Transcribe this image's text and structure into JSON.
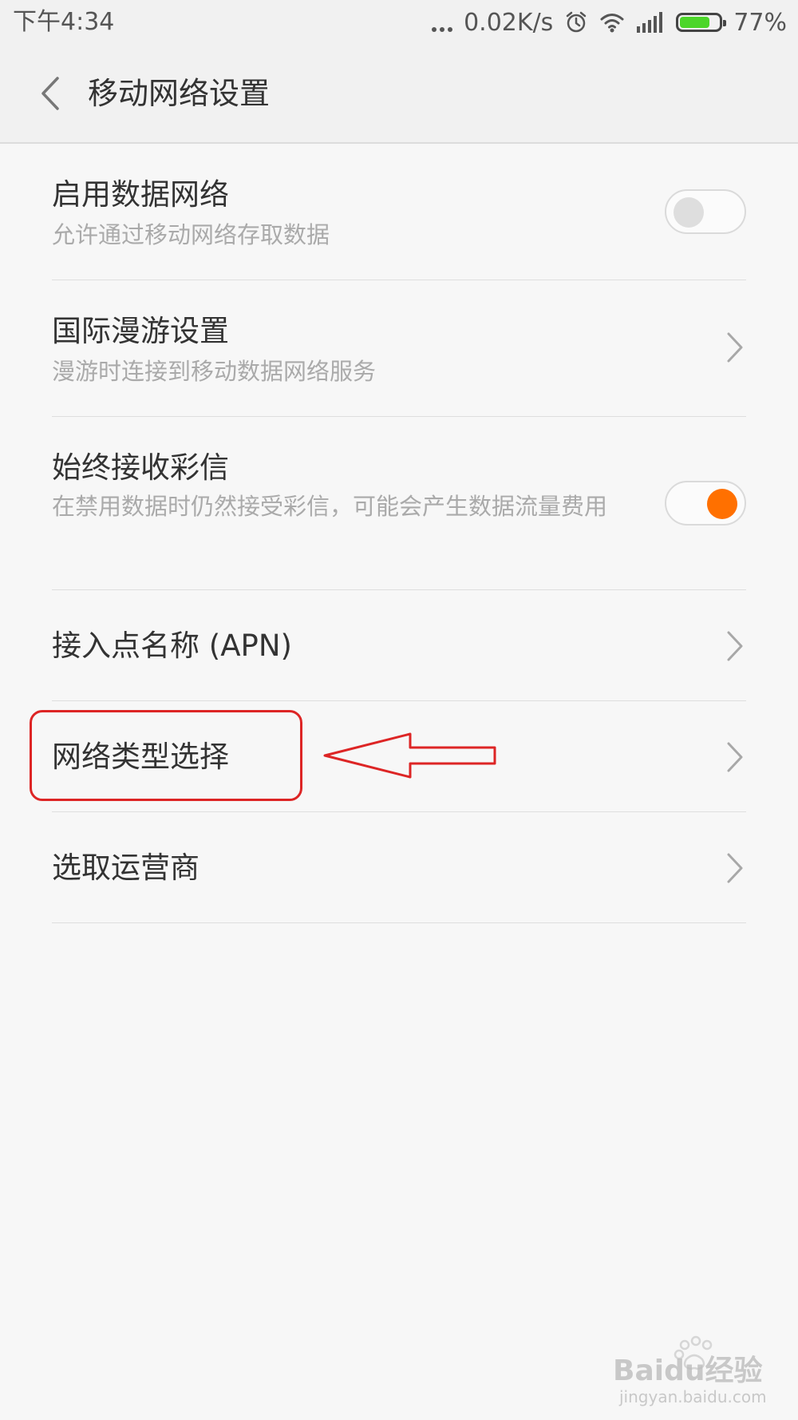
{
  "status_bar": {
    "time": "下午4:34",
    "speed": "0.02K/s",
    "battery_percent": "77%",
    "battery_level": 0.77,
    "icons": [
      "more-dots-icon",
      "alarm-clock-icon",
      "wifi-icon",
      "signal-icon",
      "battery-icon"
    ],
    "battery_color": "#4cd629"
  },
  "header": {
    "title": "移动网络设置"
  },
  "settings": {
    "items": [
      {
        "title": "启用数据网络",
        "subtitle": "允许通过移动网络存取数据",
        "control": "toggle",
        "enabled": false
      },
      {
        "title": "国际漫游设置",
        "subtitle": "漫游时连接到移动数据网络服务",
        "control": "chevron-right-icon"
      },
      {
        "title": "始终接收彩信",
        "subtitle": "在禁用数据时仍然接受彩信，可能会产生数据流量费用",
        "control": "toggle",
        "enabled": true
      },
      {
        "title": "接入点名称 (APN)",
        "control": "chevron-right-icon"
      },
      {
        "title": "网络类型选择",
        "control": "chevron-right-icon",
        "highlighted": true
      },
      {
        "title": "选取运营商",
        "control": "chevron-right-icon"
      }
    ]
  },
  "colors": {
    "accent": "#ff7000",
    "annotation": "#dd2525"
  },
  "watermark": {
    "brand": "Baidu经验",
    "url": "jingyan.baidu.com"
  }
}
